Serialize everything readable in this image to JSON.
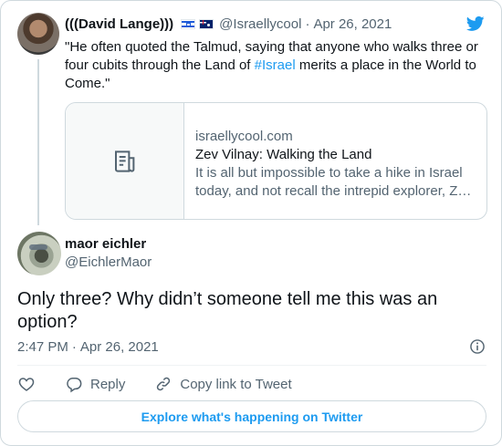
{
  "quoted_tweet": {
    "author_name": "(((David Lange)))",
    "flags": [
      "israel-flag-icon",
      "australia-flag-icon"
    ],
    "handle": "@Israellycool",
    "separator": "·",
    "date": "Apr 26, 2021",
    "text_before": "\"He often quoted the Talmud, saying that anyone who walks three or four cubits through the Land of ",
    "hashtag": "#Israel",
    "text_after": " merits a place in the World to Come.\"",
    "link_card": {
      "domain": "israellycool.com",
      "title": "Zev Vilnay: Walking the Land",
      "description": "It is all but impossible to take a hike in Israel today, and not recall the intrepid explorer, Zev Vilnay"
    }
  },
  "tweet": {
    "author_name": "maor eichler",
    "handle": "@EichlerMaor",
    "text": "Only three? Why didn’t someone tell me this was an option?",
    "time": "2:47 PM",
    "separator": "·",
    "date": "Apr 26, 2021"
  },
  "actions": {
    "reply_label": "Reply",
    "copy_label": "Copy link to Tweet"
  },
  "explore_label": "Explore what's happening on Twitter",
  "colors": {
    "accent": "#1d9bf0",
    "text": "#0f1419",
    "secondary": "#536471",
    "border": "#cfd9de"
  }
}
